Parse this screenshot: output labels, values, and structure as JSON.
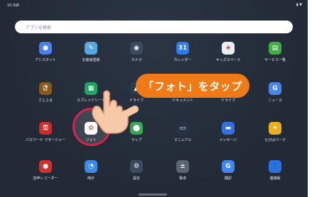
{
  "status": {
    "time": "10:30",
    "extra": "6",
    "right": "▮ ▼"
  },
  "search": {
    "placeholder": "アプリを検索"
  },
  "apps": [
    {
      "label": "アシスタント",
      "icon": "google-assistant-icon",
      "color": "#4b7ff0",
      "glyph": "●"
    },
    {
      "label": "お客様登録",
      "icon": "customer-registration-icon",
      "color": "#58a7e0",
      "glyph": "✎"
    },
    {
      "label": "カメラ",
      "icon": "camera-icon",
      "color": "#3b4a5e",
      "glyph": "◉"
    },
    {
      "label": "カレンダー",
      "icon": "calendar-icon",
      "color": "#2e7bea",
      "glyph": "31"
    },
    {
      "label": "キッズスペース",
      "icon": "kids-space-icon",
      "color": "#e9eef5",
      "glyph": "★"
    },
    {
      "label": "サービス一覧",
      "icon": "service-list-icon",
      "color": "#3fae49",
      "glyph": "▤"
    },
    {
      "label": "さとふる",
      "icon": "satofull-icon",
      "color": "#8a5a1c",
      "glyph": "さ"
    },
    {
      "label": "スプレッドシート",
      "icon": "sheets-icon",
      "color": "#1fa463",
      "glyph": "▦"
    },
    {
      "label": "ドライブ",
      "icon": "drive-icon",
      "color": "#2d3b4e",
      "glyph": "▲"
    },
    {
      "label": "ドキュメント",
      "icon": "docs-icon",
      "color": "#3c78f0",
      "glyph": "≡"
    },
    {
      "label": "ドライブ",
      "icon": "drive-icon",
      "color": "#2d3b4e",
      "glyph": "△"
    },
    {
      "label": "ニュース",
      "icon": "news-icon",
      "color": "#4a86e8",
      "glyph": "G"
    },
    {
      "label": "パスワード マネージャー",
      "icon": "password-manager-icon",
      "color": "#d12a2a",
      "glyph": "⚿"
    },
    {
      "label": "フォト",
      "icon": "photos-icon",
      "color": "#ffffff",
      "glyph": "✿"
    },
    {
      "label": "マップ",
      "icon": "maps-icon",
      "color": "#34a853",
      "glyph": "⬤"
    },
    {
      "label": "マニュアル",
      "icon": "manual-icon",
      "color": "#273448",
      "glyph": "▭"
    },
    {
      "label": "メッセージ",
      "icon": "messages-icon",
      "color": "#3470e4",
      "glyph": "▬"
    },
    {
      "label": "らびばパーク",
      "icon": "rabiba-park-icon",
      "color": "#e9b020",
      "glyph": "✦"
    },
    {
      "label": "音声レコーダー",
      "icon": "voice-recorder-icon",
      "color": "#d32f2f",
      "glyph": "●"
    },
    {
      "label": "時計",
      "icon": "clock-icon",
      "color": "#3b8be8",
      "glyph": "◔"
    },
    {
      "label": "設定",
      "icon": "settings-icon",
      "color": "#3b4a5e",
      "glyph": "⚙"
    },
    {
      "label": "電卓",
      "icon": "calculator-icon",
      "color": "#5a6472",
      "glyph": "±"
    },
    {
      "label": "翻訳",
      "icon": "translate-icon",
      "color": "#4285f4",
      "glyph": "G"
    },
    {
      "label": "連絡帳",
      "icon": "contacts-icon",
      "color": "#2e6ee6",
      "glyph": "👤"
    }
  ],
  "callout": {
    "text": "「フォト」をタップ"
  },
  "colors": {
    "background": "#222a36",
    "callout": "#f07a15",
    "ring": "#d9234f"
  }
}
